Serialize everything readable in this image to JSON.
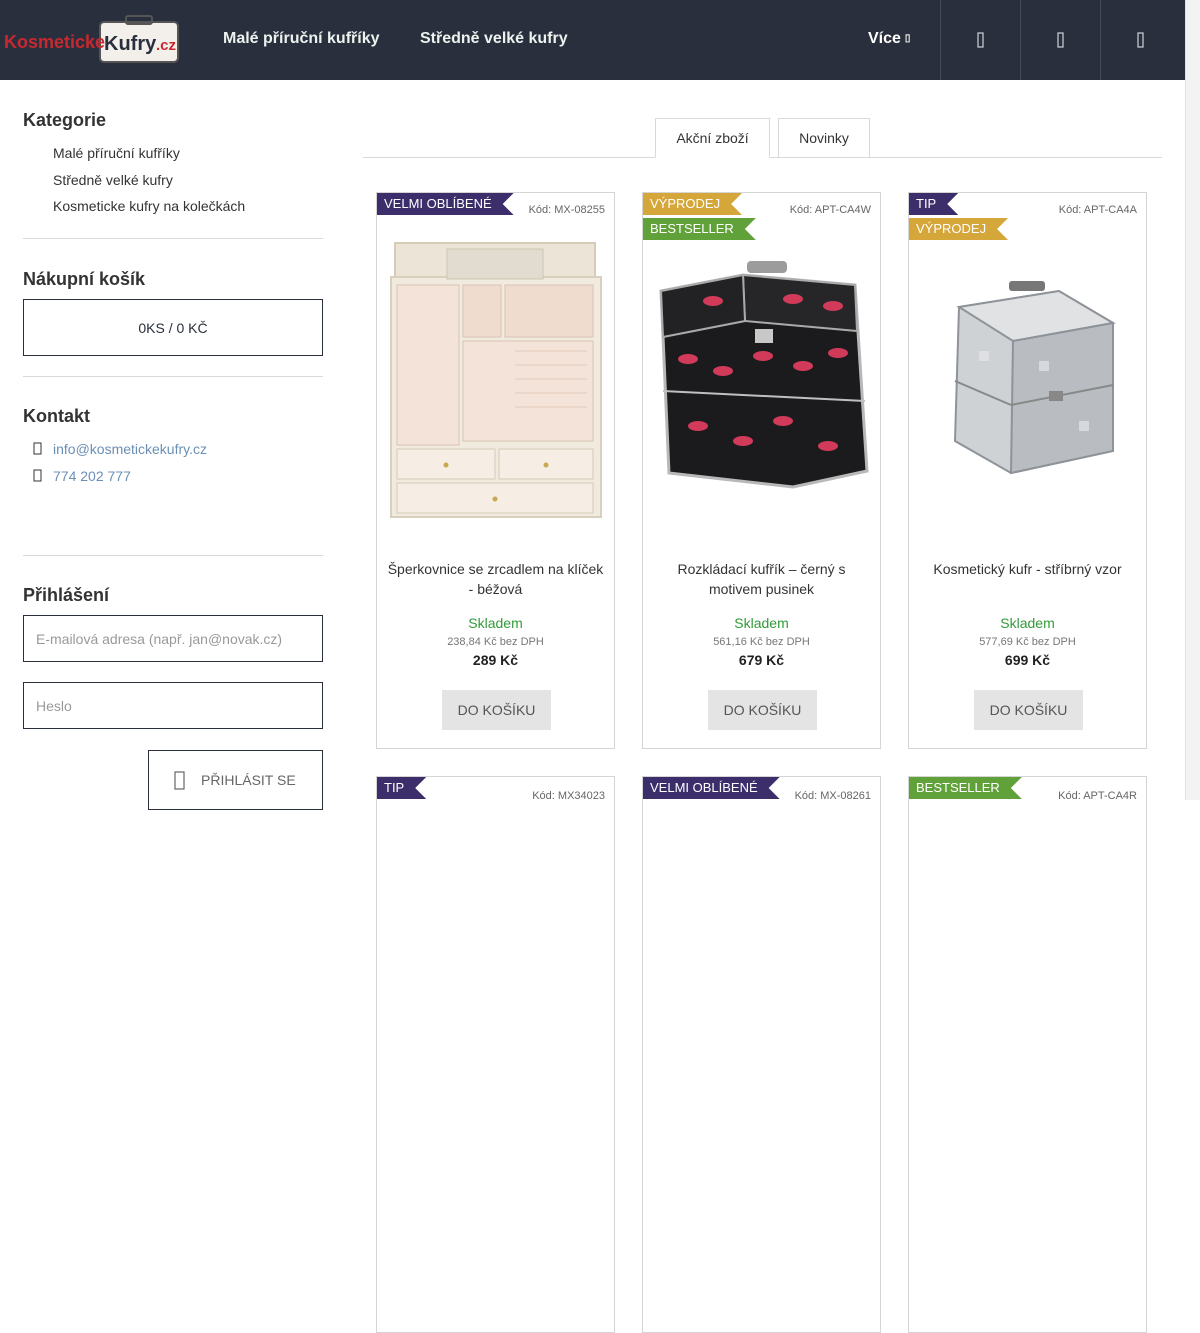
{
  "header": {
    "logo_alt": "KosmetickeKufry.cz",
    "nav": [
      "Malé příruční kufříky",
      "Středně velké kufry"
    ],
    "more_label": "Více",
    "icons": [
      "search-icon",
      "user-icon",
      "cart-icon"
    ]
  },
  "sidebar": {
    "categories_title": "Kategorie",
    "categories": [
      "Malé příruční kufříky",
      "Středně velké kufry",
      "Kosmeticke kufry na kolečkách"
    ],
    "cart_title": "Nákupní košík",
    "cart_summary": "0KS / 0 KČ",
    "contact_title": "Kontakt",
    "email": "info@kosmetickekufry.cz",
    "phone": "774 202 777",
    "login_title": "Přihlášení",
    "email_placeholder": "E-mailová adresa (např. jan@novak.cz)",
    "password_placeholder": "Heslo",
    "login_button": "Přihlásit se"
  },
  "tabs": [
    "Akční zboží",
    "Novinky"
  ],
  "products": [
    {
      "flags": [
        "VELMI OBLÍBENÉ"
      ],
      "code": "Kód: MX-08255",
      "name": "Šperkovnice se zrcadlem na klíček - béžová",
      "stock": "Skladem",
      "net": "238,84 Kč bez DPH",
      "price": "289 Kč",
      "buy": "Do košíku"
    },
    {
      "flags": [
        "VÝPRODEJ",
        "BESTSELLER"
      ],
      "code": "Kód: APT-CA4W",
      "name": "Rozkládací kufřík – černý s motivem pusinek",
      "stock": "Skladem",
      "net": "561,16 Kč bez DPH",
      "price": "679 Kč",
      "buy": "Do košíku"
    },
    {
      "flags": [
        "TIP",
        "VÝPRODEJ"
      ],
      "code": "Kód: APT-CA4A",
      "name": "Kosmetický kufr - stříbrný vzor",
      "stock": "Skladem",
      "net": "577,69 Kč bez DPH",
      "price": "699 Kč",
      "buy": "Do košíku"
    }
  ],
  "products_row2": [
    {
      "flag": "TIP",
      "code": "Kód: MX34023"
    },
    {
      "flag": "VELMI OBLÍBENÉ",
      "code": "Kód: MX-08261"
    },
    {
      "flag": "BESTSELLER",
      "code": "Kód: APT-CA4R"
    }
  ],
  "colors": {
    "header_bg": "#2a2f3d",
    "flag_popular": "#3c2e6b",
    "flag_sale": "#d5a63a",
    "flag_best": "#61a13a",
    "stock_green": "#329b3a",
    "link_blue": "#6b8fb4"
  }
}
